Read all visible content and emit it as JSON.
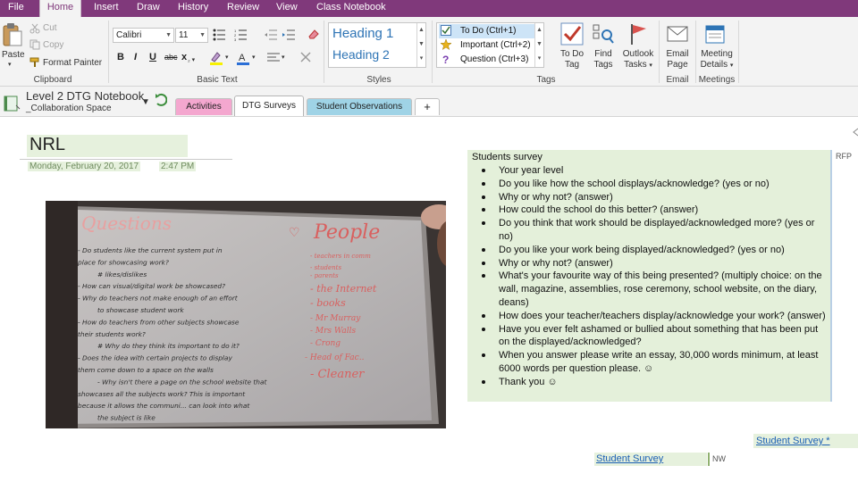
{
  "ribbon": {
    "tabs": [
      "File",
      "Home",
      "Insert",
      "Draw",
      "History",
      "Review",
      "View",
      "Class Notebook"
    ],
    "active_tab": "Home",
    "clipboard": {
      "paste": "Paste",
      "cut": "Cut",
      "copy": "Copy",
      "format_painter": "Format Painter",
      "group_label": "Clipboard"
    },
    "basic_text": {
      "font": "Calibri",
      "size": "11",
      "bold": "B",
      "italic": "I",
      "underline": "U",
      "strike": "abc",
      "subscript": "x",
      "group_label": "Basic Text"
    },
    "styles": {
      "heading1": "Heading 1",
      "heading2": "Heading 2",
      "group_label": "Styles"
    },
    "tags": {
      "items": [
        "To Do (Ctrl+1)",
        "Important (Ctrl+2)",
        "Question (Ctrl+3)"
      ],
      "todo_tag": [
        "To Do",
        "Tag"
      ],
      "find_tags": [
        "Find",
        "Tags"
      ],
      "outlook_tasks": [
        "Outlook",
        "Tasks"
      ],
      "group_label": "Tags"
    },
    "email": {
      "label": [
        "Email",
        "Page"
      ],
      "group_label": "Email"
    },
    "meetings": {
      "label": [
        "Meeting",
        "Details"
      ],
      "group_label": "Meetings"
    }
  },
  "notebook": {
    "name": "Level 2 DTG Notebook",
    "section_group": "_Collaboration Space",
    "sections": [
      "Activities",
      "DTG Surveys",
      "Student Observations",
      "+"
    ],
    "active_section": "DTG Surveys"
  },
  "page": {
    "title": "NRL",
    "date": "Monday, February 20, 2017",
    "time": "2:47 PM",
    "survey": {
      "title": "Students survey",
      "items": [
        "Your year level",
        "Do you like how the school displays/acknowledge? (yes or no)",
        "Why or why not? (answer)",
        "How could the school do this better? (answer)",
        "Do you think that work should be displayed/acknowledged more? (yes or no)",
        "Do you like your work being displayed/acknowledged? (yes or no)",
        "Why or why not? (answer)",
        "What's your favourite way of this being presented? (multiply choice: on the wall, magazine, assemblies, rose ceremony, school website, on the diary, deans)",
        "How does your teacher/teachers display/acknowledge your work? (answer)",
        "Have you ever felt ashamed or bullied about something that has been put on the displayed/acknowledged?",
        "When you answer please write an essay, 30,000 words minimum, at least 6000 words per question please. ☺",
        "Thank you ☺"
      ],
      "author_tag": "RFP"
    },
    "link_survey_star": "Student Survey *",
    "link_survey": "Student Survey",
    "author_tag_2": "NW",
    "whiteboard": {
      "left_heading": "Questions",
      "right_heading": "People",
      "left_lines": [
        "- Do students like the current system put in",
        "place for showcasing work?",
        "# likes/dislikes",
        "- How can visual/digital work be showcased?",
        "- Why do teachers not make enough of an effort",
        "to showcase student work",
        "- How do teachers from other subjects showcase",
        "their students work?",
        "# Why do they think its important to do it?",
        "- Does the idea with certain projects to display",
        "them come down to a space on the walls",
        "- Why isn't there a page on the school website that",
        "showcases all the subjects work? This is important",
        "because it allows the communi... can look into what",
        "the subject is like"
      ],
      "right_lines": [
        "- teachers in comm",
        "- students",
        "- parents",
        "- the Internet",
        "- books",
        "- Mr Murray",
        "- Mrs Walls",
        "- Crong",
        "- Head of Fac..",
        "- Cleaner"
      ]
    }
  },
  "colors": {
    "onenote_purple": "#80397b",
    "tag_highlight": "#e4f0da",
    "link_blue": "#1a5fb4",
    "heading_blue": "#2e74b5"
  }
}
